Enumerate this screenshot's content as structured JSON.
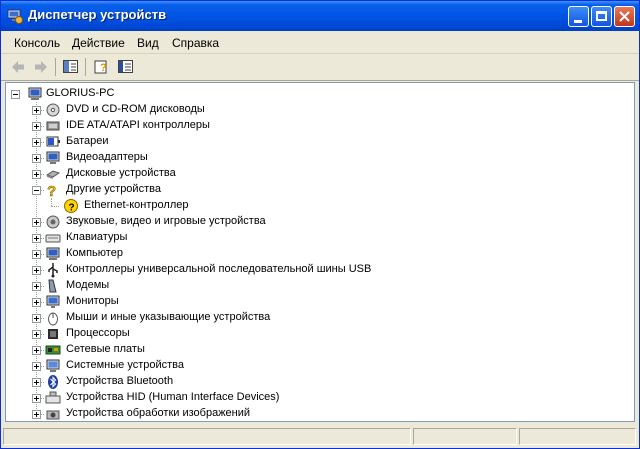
{
  "window": {
    "title": "Диспетчер устройств"
  },
  "menu": {
    "items": [
      "Консоль",
      "Действие",
      "Вид",
      "Справка"
    ]
  },
  "tree": {
    "root": "GLORIUS-PC",
    "items": [
      {
        "label": "DVD и CD-ROM дисководы",
        "icon": "dvd-drive-icon"
      },
      {
        "label": "IDE ATA/ATAPI контроллеры",
        "icon": "ide-controller-icon"
      },
      {
        "label": "Батареи",
        "icon": "battery-icon"
      },
      {
        "label": "Видеоадаптеры",
        "icon": "display-adapter-icon"
      },
      {
        "label": "Дисковые устройства",
        "icon": "disk-drive-icon"
      },
      {
        "label": "Другие устройства",
        "icon": "unknown-device-icon",
        "expanded": true
      },
      {
        "label": "Ethernet-контроллер",
        "icon": "warning-device-icon",
        "child": true
      },
      {
        "label": "Звуковые, видео и игровые устройства",
        "icon": "sound-icon"
      },
      {
        "label": "Клавиатуры",
        "icon": "keyboard-icon"
      },
      {
        "label": "Компьютер",
        "icon": "computer-icon"
      },
      {
        "label": "Контроллеры универсальной последовательной шины USB",
        "icon": "usb-icon"
      },
      {
        "label": "Модемы",
        "icon": "modem-icon"
      },
      {
        "label": "Мониторы",
        "icon": "monitor-icon"
      },
      {
        "label": "Мыши и иные указывающие устройства",
        "icon": "mouse-icon"
      },
      {
        "label": "Процессоры",
        "icon": "processor-icon"
      },
      {
        "label": "Сетевые платы",
        "icon": "network-adapter-icon"
      },
      {
        "label": "Системные устройства",
        "icon": "system-device-icon"
      },
      {
        "label": "Устройства Bluetooth",
        "icon": "bluetooth-icon"
      },
      {
        "label": "Устройства HID (Human Interface Devices)",
        "icon": "hid-icon"
      },
      {
        "label": "Устройства обработки изображений",
        "icon": "imaging-device-icon"
      }
    ]
  },
  "colors": {
    "titlebar": "#0055e5",
    "accent": "#0a246a",
    "warning": "#f7d117"
  }
}
